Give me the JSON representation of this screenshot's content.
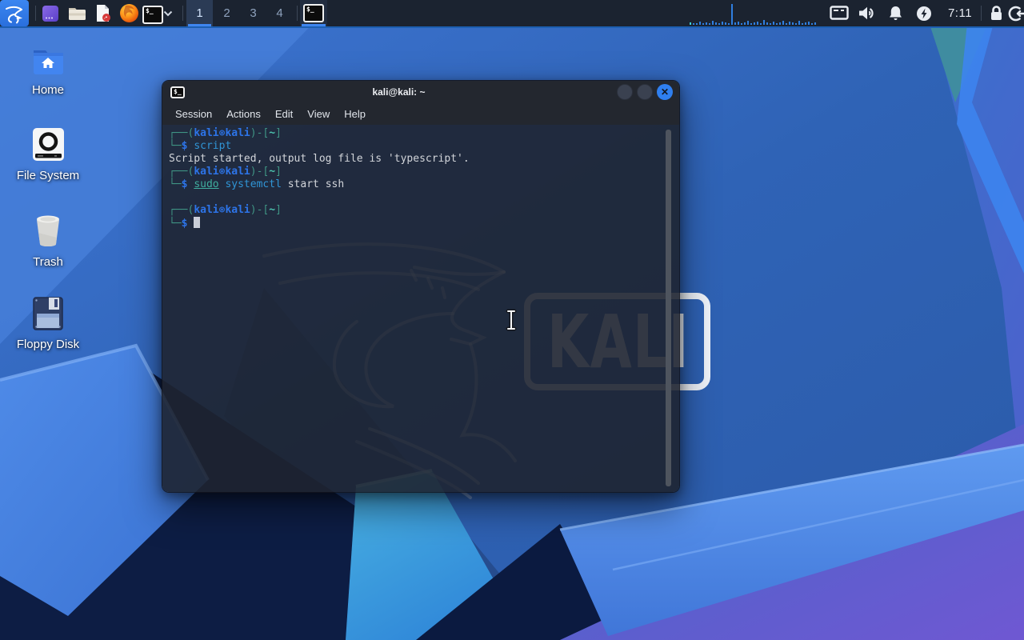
{
  "colors": {
    "panel-underline": "#3f86f0",
    "chrome": "#23272f",
    "term-bg": "rgba(30,36,48,0.90)",
    "c-frame": "#3f9484",
    "c-user": "#2d74e8",
    "c-path": "#4cc2ae",
    "c-dollar": "#2d74e8",
    "c-cmd": "#3095d6",
    "c-pre": "#3fae9e",
    "c-plain": "#d2d5da",
    "c-cursor": "#c9ced8"
  },
  "wallpaper": {
    "logo_text": "KALI"
  },
  "panel": {
    "launchers": [
      "kali-menu",
      "show-desktop",
      "file-manager",
      "text-editor",
      "firefox-browser",
      "terminal-emulator"
    ],
    "terminal_glyph": "$_",
    "workspaces": [
      {
        "label": "1",
        "active": true
      },
      {
        "label": "2",
        "active": false
      },
      {
        "label": "3",
        "active": false
      },
      {
        "label": "4",
        "active": false
      }
    ],
    "window_button_glyph": "$_",
    "monitor_bars": [
      3,
      2,
      2,
      4,
      2,
      3,
      2,
      5,
      3,
      2,
      4,
      3,
      2,
      26,
      3,
      4,
      2,
      3,
      5,
      2,
      3,
      4,
      2,
      6,
      3,
      2,
      4,
      2,
      3,
      5,
      2,
      4,
      3,
      2,
      5,
      2,
      3,
      4,
      2,
      3
    ],
    "tray": [
      "display",
      "volume",
      "notifications",
      "power-manager",
      "clock",
      "lock-screen",
      "log-out"
    ],
    "clock": "7:11"
  },
  "desktop_icons": [
    {
      "label": "Home"
    },
    {
      "label": "File System"
    },
    {
      "label": "Trash"
    },
    {
      "label": "Floppy Disk"
    }
  ],
  "terminal": {
    "title": "kali@kali: ~",
    "titlebar_icon_glyph": "$_",
    "close_glyph": "✕",
    "menus": [
      "Session",
      "Actions",
      "Edit",
      "View",
      "Help"
    ],
    "lines": [
      {
        "segments": [
          {
            "text": "┌──(",
            "style": "frame"
          },
          {
            "text": "kali",
            "style": "user-bold"
          },
          {
            "text": "⊛",
            "style": "user-sym"
          },
          {
            "text": "kali",
            "style": "user-bold"
          },
          {
            "text": ")-[",
            "style": "frame"
          },
          {
            "text": "~",
            "style": "path"
          },
          {
            "text": "]",
            "style": "frame"
          }
        ]
      },
      {
        "segments": [
          {
            "text": "└─",
            "style": "frame"
          },
          {
            "text": "$",
            "style": "dollar"
          },
          {
            "text": " ",
            "style": "plain"
          },
          {
            "text": "script",
            "style": "command"
          }
        ]
      },
      {
        "segments": [
          {
            "text": "Script started, output log file is 'typescript'.",
            "style": "plain"
          }
        ]
      },
      {
        "segments": [
          {
            "text": "┌──(",
            "style": "frame"
          },
          {
            "text": "kali",
            "style": "user-bold"
          },
          {
            "text": "⊛",
            "style": "user-sym"
          },
          {
            "text": "kali",
            "style": "user-bold"
          },
          {
            "text": ")-[",
            "style": "frame"
          },
          {
            "text": "~",
            "style": "path"
          },
          {
            "text": "]",
            "style": "frame"
          }
        ]
      },
      {
        "segments": [
          {
            "text": "└─",
            "style": "frame"
          },
          {
            "text": "$",
            "style": "dollar"
          },
          {
            "text": " ",
            "style": "plain"
          },
          {
            "text": "sudo",
            "style": "precommand"
          },
          {
            "text": " ",
            "style": "plain"
          },
          {
            "text": "systemctl",
            "style": "command"
          },
          {
            "text": " start ssh",
            "style": "plain"
          }
        ]
      },
      {
        "segments": []
      },
      {
        "segments": [
          {
            "text": "┌──(",
            "style": "frame"
          },
          {
            "text": "kali",
            "style": "user-bold"
          },
          {
            "text": "⊛",
            "style": "user-sym"
          },
          {
            "text": "kali",
            "style": "user-bold"
          },
          {
            "text": ")-[",
            "style": "frame"
          },
          {
            "text": "~",
            "style": "path"
          },
          {
            "text": "]",
            "style": "frame"
          }
        ]
      },
      {
        "segments": [
          {
            "text": "└─",
            "style": "frame"
          },
          {
            "text": "$",
            "style": "dollar"
          },
          {
            "text": " ",
            "style": "plain"
          }
        ],
        "cursor": true
      }
    ]
  }
}
